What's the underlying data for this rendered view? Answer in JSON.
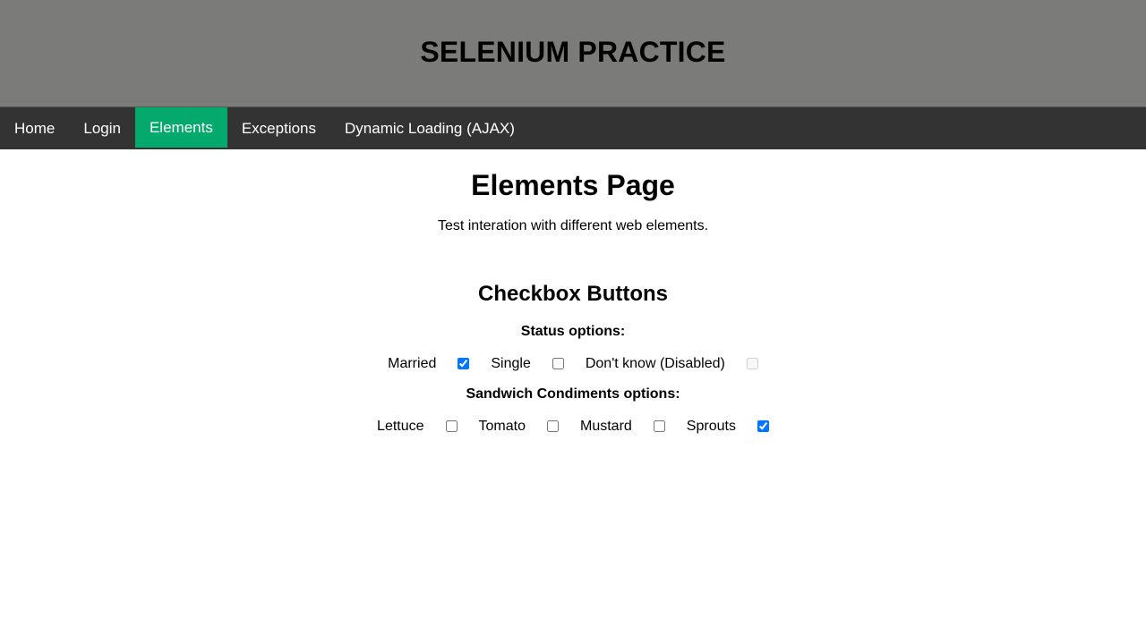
{
  "header": {
    "title": "SELENIUM PRACTICE"
  },
  "nav": {
    "items": [
      {
        "label": "Home",
        "active": false
      },
      {
        "label": "Login",
        "active": false
      },
      {
        "label": "Elements",
        "active": true
      },
      {
        "label": "Exceptions",
        "active": false
      },
      {
        "label": "Dynamic Loading (AJAX)",
        "active": false
      }
    ]
  },
  "page": {
    "title": "Elements Page",
    "subtitle": "Test interation with different web elements."
  },
  "checkbox_section": {
    "title": "Checkbox Buttons",
    "status": {
      "label": "Status options:",
      "options": [
        {
          "label": "Married",
          "checked": true,
          "disabled": false
        },
        {
          "label": "Single",
          "checked": false,
          "disabled": false
        },
        {
          "label": "Don't know (Disabled)",
          "checked": false,
          "disabled": true
        }
      ]
    },
    "condiments": {
      "label": "Sandwich Condiments options:",
      "options": [
        {
          "label": "Lettuce",
          "checked": false,
          "disabled": false
        },
        {
          "label": "Tomato",
          "checked": false,
          "disabled": false
        },
        {
          "label": "Mustard",
          "checked": false,
          "disabled": false
        },
        {
          "label": "Sprouts",
          "checked": true,
          "disabled": false
        }
      ]
    }
  },
  "colors": {
    "header_bg": "#7b7c7a",
    "nav_bg": "#333333",
    "nav_active_bg": "#04aa6d",
    "checkbox_accent": "#0075ff"
  }
}
